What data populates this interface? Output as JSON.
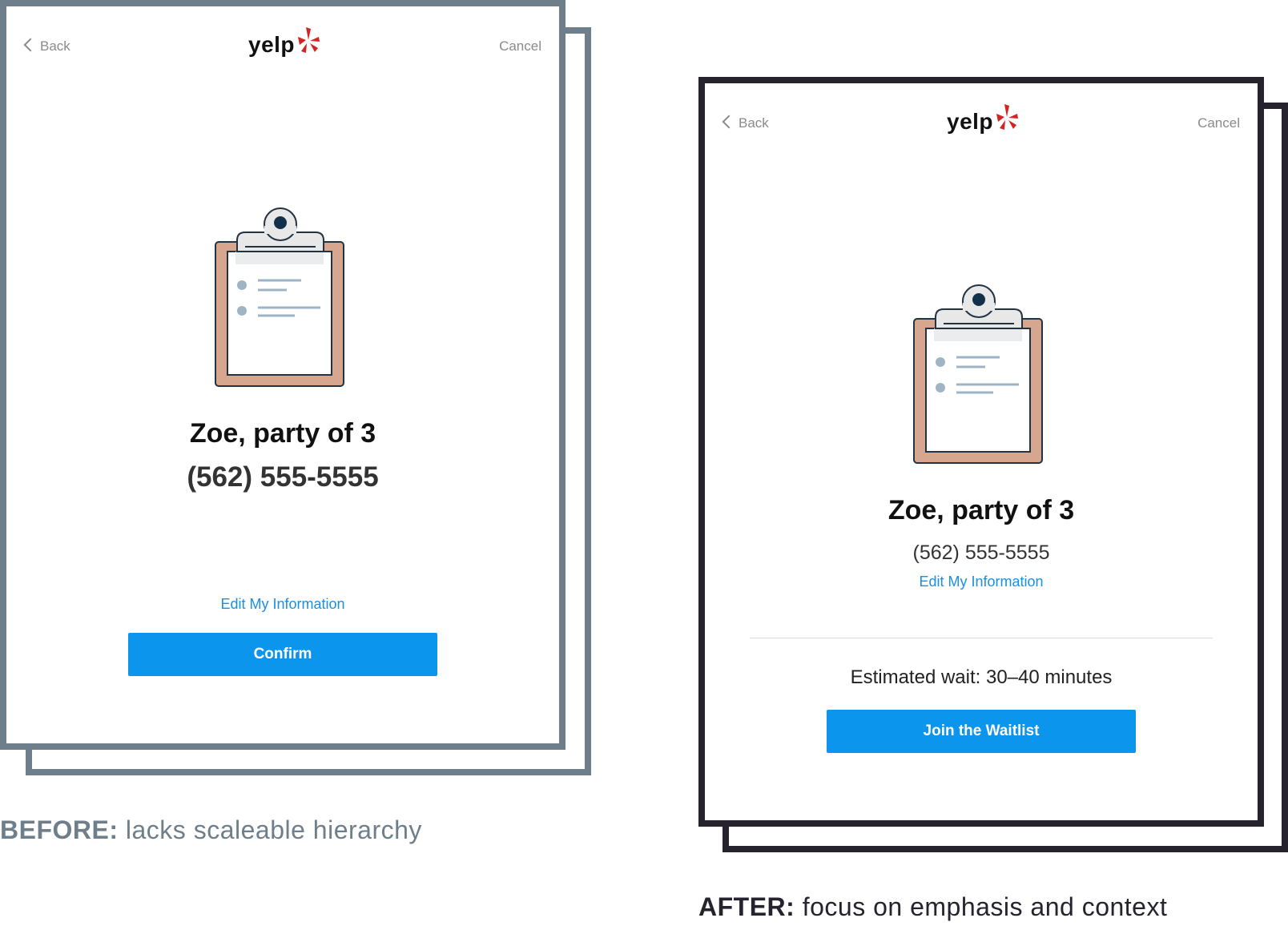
{
  "before": {
    "nav": {
      "back_label": "Back",
      "cancel_label": "Cancel"
    },
    "logo_text": "yelp",
    "name_line": "Zoe, party of 3",
    "phone": "(562) 555-5555",
    "edit_link": "Edit My Information",
    "button_label": "Confirm",
    "caption_lead": "BEFORE:",
    "caption_text": " lacks scaleable hierarchy"
  },
  "after": {
    "nav": {
      "back_label": "Back",
      "cancel_label": "Cancel"
    },
    "logo_text": "yelp",
    "name_line": "Zoe, party of 3",
    "phone": "(562) 555-5555",
    "edit_link": "Edit My Information",
    "wait_text": "Estimated wait: 30–40 minutes",
    "button_label": "Join the Waitlist",
    "caption_lead": "AFTER:",
    "caption_text": " focus on emphasis and context"
  },
  "icons": [
    "chevron-left-icon",
    "yelp-burst-icon",
    "clipboard-icon"
  ],
  "colors": {
    "before_frame": "#6e7e8a",
    "after_frame": "#26232f",
    "button_blue": "#0b95ed",
    "link_blue": "#1a8fe3",
    "logo_red": "#d32323",
    "clipboard_board": "#d6a68f",
    "clipboard_bullets": "#9fb4c4"
  }
}
